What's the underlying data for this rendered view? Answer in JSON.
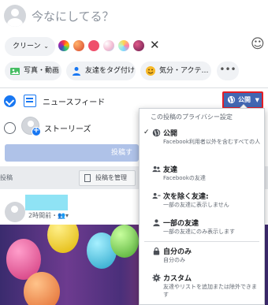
{
  "composer": {
    "prompt": "今なにしてる？",
    "background_select": {
      "label": "クリーン"
    },
    "background_swatches": [
      "#7b4bd6",
      "#ff7a59",
      "#ef4f6b",
      "#e8e8e8",
      "#f7b500",
      "#c2185b"
    ],
    "actions": [
      {
        "label": "写真・動画",
        "icon": "photo-icon"
      },
      {
        "label": "友達をタグ付け",
        "icon": "tag-friends-icon"
      },
      {
        "label": "気分・アクテ…",
        "icon": "feeling-icon"
      }
    ],
    "more_label": "•••"
  },
  "destinations": [
    {
      "label": "ニュースフィード",
      "selected": true
    },
    {
      "label": "ストーリーズ",
      "selected": false
    }
  ],
  "privacy_button": {
    "label": "公開"
  },
  "post_button": {
    "label": "投稿す"
  },
  "page": {
    "left_cut_text": "投稿",
    "manage_label": "投稿を管理",
    "post_meta": "2時間前・"
  },
  "privacy_menu": {
    "header": "この投稿のプライバシー設定",
    "items": [
      {
        "title": "公開",
        "desc": "Facebook利用者以外を含むすべての人",
        "icon": "globe-icon",
        "checked": true
      },
      {
        "title": "友達",
        "desc": "Facebookの友達",
        "icon": "friends-icon",
        "checked": false
      },
      {
        "title": "次を除く友達:",
        "desc": "一部の友達に表示しません",
        "icon": "friends-except-icon",
        "checked": false
      },
      {
        "title": "一部の友達",
        "desc": "一部の友達にのみ表示します",
        "icon": "specific-friends-icon",
        "checked": false
      },
      {
        "title": "自分のみ",
        "desc": "自分のみ",
        "icon": "lock-icon",
        "checked": false
      },
      {
        "title": "カスタム",
        "desc": "友達やリストを追加または除外できます",
        "icon": "gear-icon",
        "checked": false
      }
    ]
  },
  "colors": {
    "facebook_blue": "#1877f2",
    "public_button": "#4267b2",
    "highlight_border": "#e41e26",
    "name_placeholder": "#8fe3f5"
  }
}
